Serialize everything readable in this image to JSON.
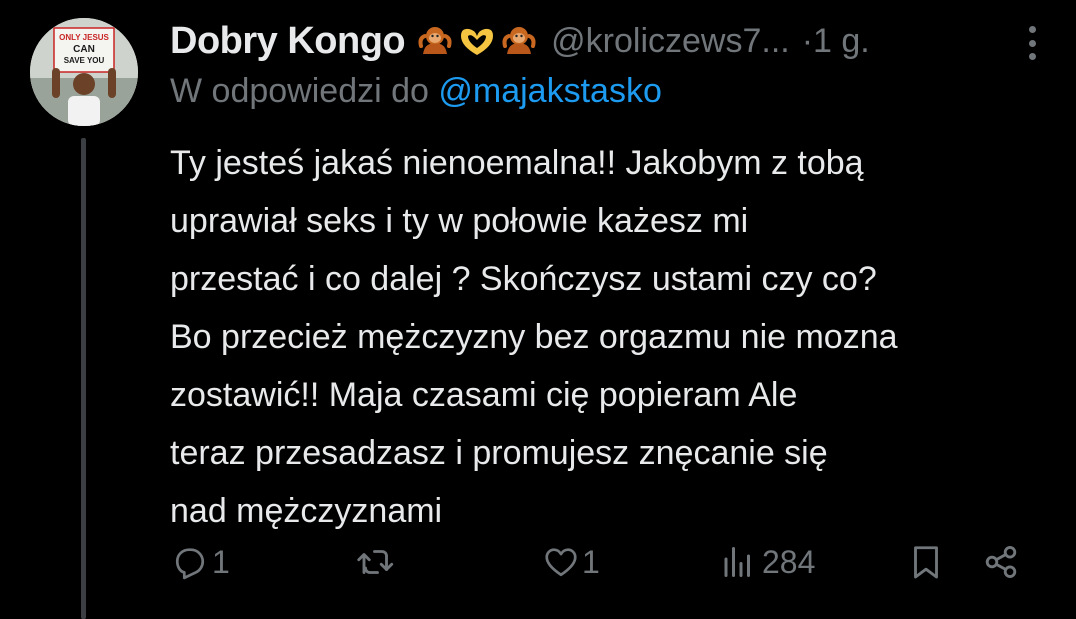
{
  "author": {
    "name": "Dobry Kongo",
    "emojis": [
      "orangutan-emoji",
      "heart-hands-emoji",
      "orangutan-emoji"
    ],
    "handle": "@kroliczews7...",
    "time": "·1 g."
  },
  "avatar": {
    "sign_text": [
      "ONLY JESUS",
      "CAN",
      "SAVE YOU"
    ]
  },
  "reply": {
    "prefix": "W odpowiedzi do",
    "mention": "@majakstasko"
  },
  "tweet": {
    "lines": [
      "Ty jesteś jakaś nienoemalna!! Jakobym z tobą",
      "uprawiał seks i ty w połowie każesz mi",
      "przestać i co dalej ? Skończysz ustami czy co?",
      "Bo przecież mężczyzny bez orgazmu nie mozna",
      "zostawić!! Maja czasami cię popieram Ale",
      "teraz przesadzasz i promujesz znęcanie się",
      "nad mężczyznami"
    ]
  },
  "actions": {
    "reply_count": "1",
    "retweet_count": "",
    "like_count": "1",
    "views_count": "284"
  },
  "colors": {
    "background": "#000000",
    "text": "#e7e9ea",
    "secondary": "#71767b",
    "link": "#1d9bf0",
    "thread_line": "#3b3f43"
  }
}
